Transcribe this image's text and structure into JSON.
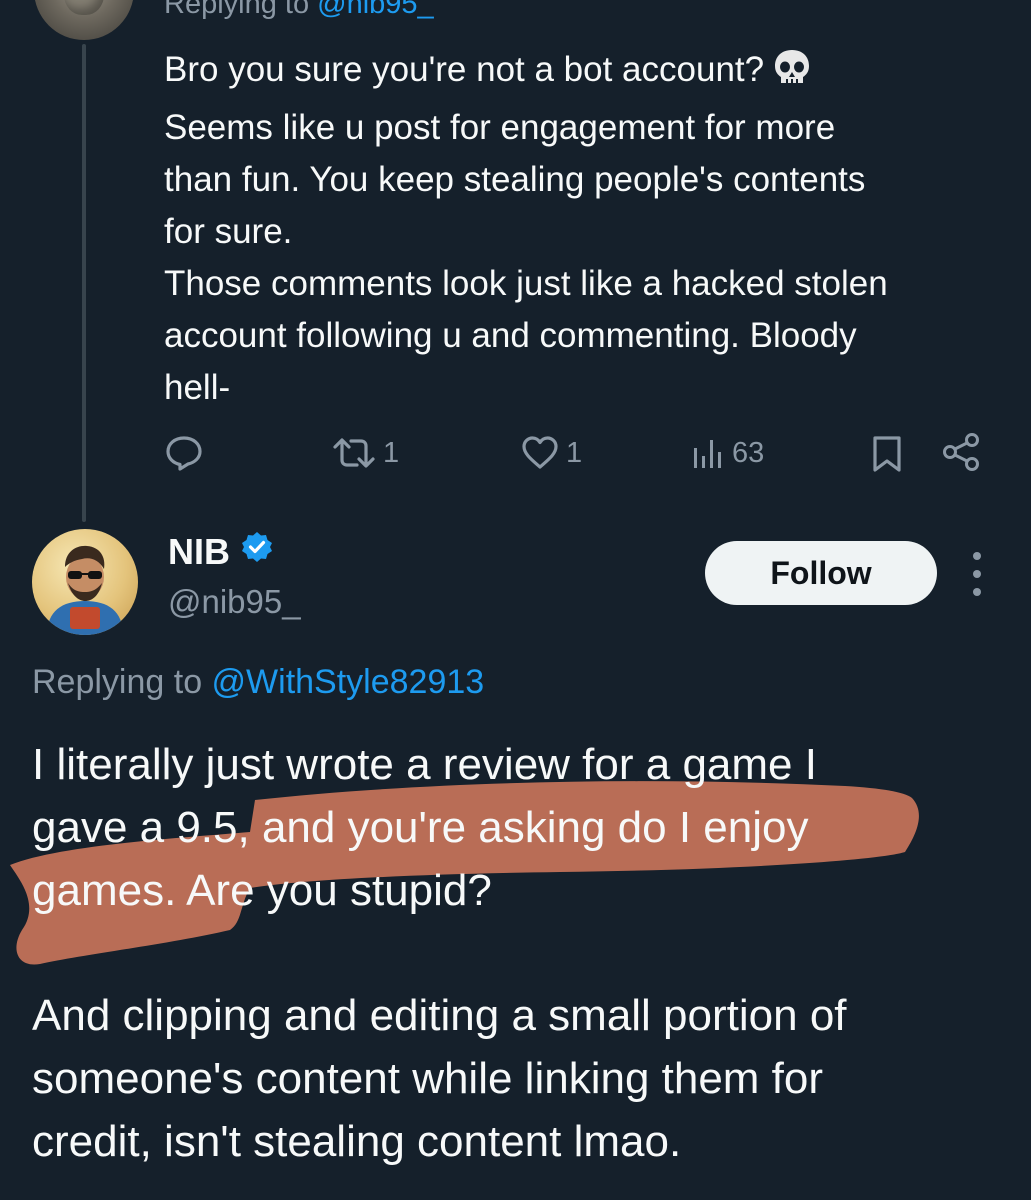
{
  "parent_tweet": {
    "replying_prefix": "Replying to ",
    "replying_handle": "@nib95_",
    "lines": [
      "Bro you sure you're not a bot account?",
      "Seems like u post for engagement for more",
      "than fun. You keep stealing people's contents",
      "for sure.",
      "Those comments look just like a hacked stolen",
      "account following u and commenting. Bloody",
      "hell-"
    ],
    "emoji_icon": "skull-icon",
    "actions": {
      "reply_count": "",
      "retweet_count": "1",
      "like_count": "1",
      "views_count": "63"
    }
  },
  "reply_tweet": {
    "display_name": "NIB",
    "verified": true,
    "handle": "@nib95_",
    "follow_label": "Follow",
    "replying_prefix": "Replying to ",
    "replying_handle": "@WithStyle82913",
    "paragraph1": [
      "I literally just wrote a review for a game I",
      "gave a 9.5, and you're asking do I enjoy",
      "games. Are you stupid?"
    ],
    "paragraph2": [
      "And clipping and editing a small portion of",
      "someone's content while linking them for",
      "credit, isn't stealing content lmao."
    ]
  },
  "colors": {
    "background": "#15202b",
    "text": "#f7f9f9",
    "muted": "#8b98a5",
    "link": "#1d9bf0",
    "verified_badge": "#1d9bf0",
    "highlight_stroke": "#c8745a"
  }
}
